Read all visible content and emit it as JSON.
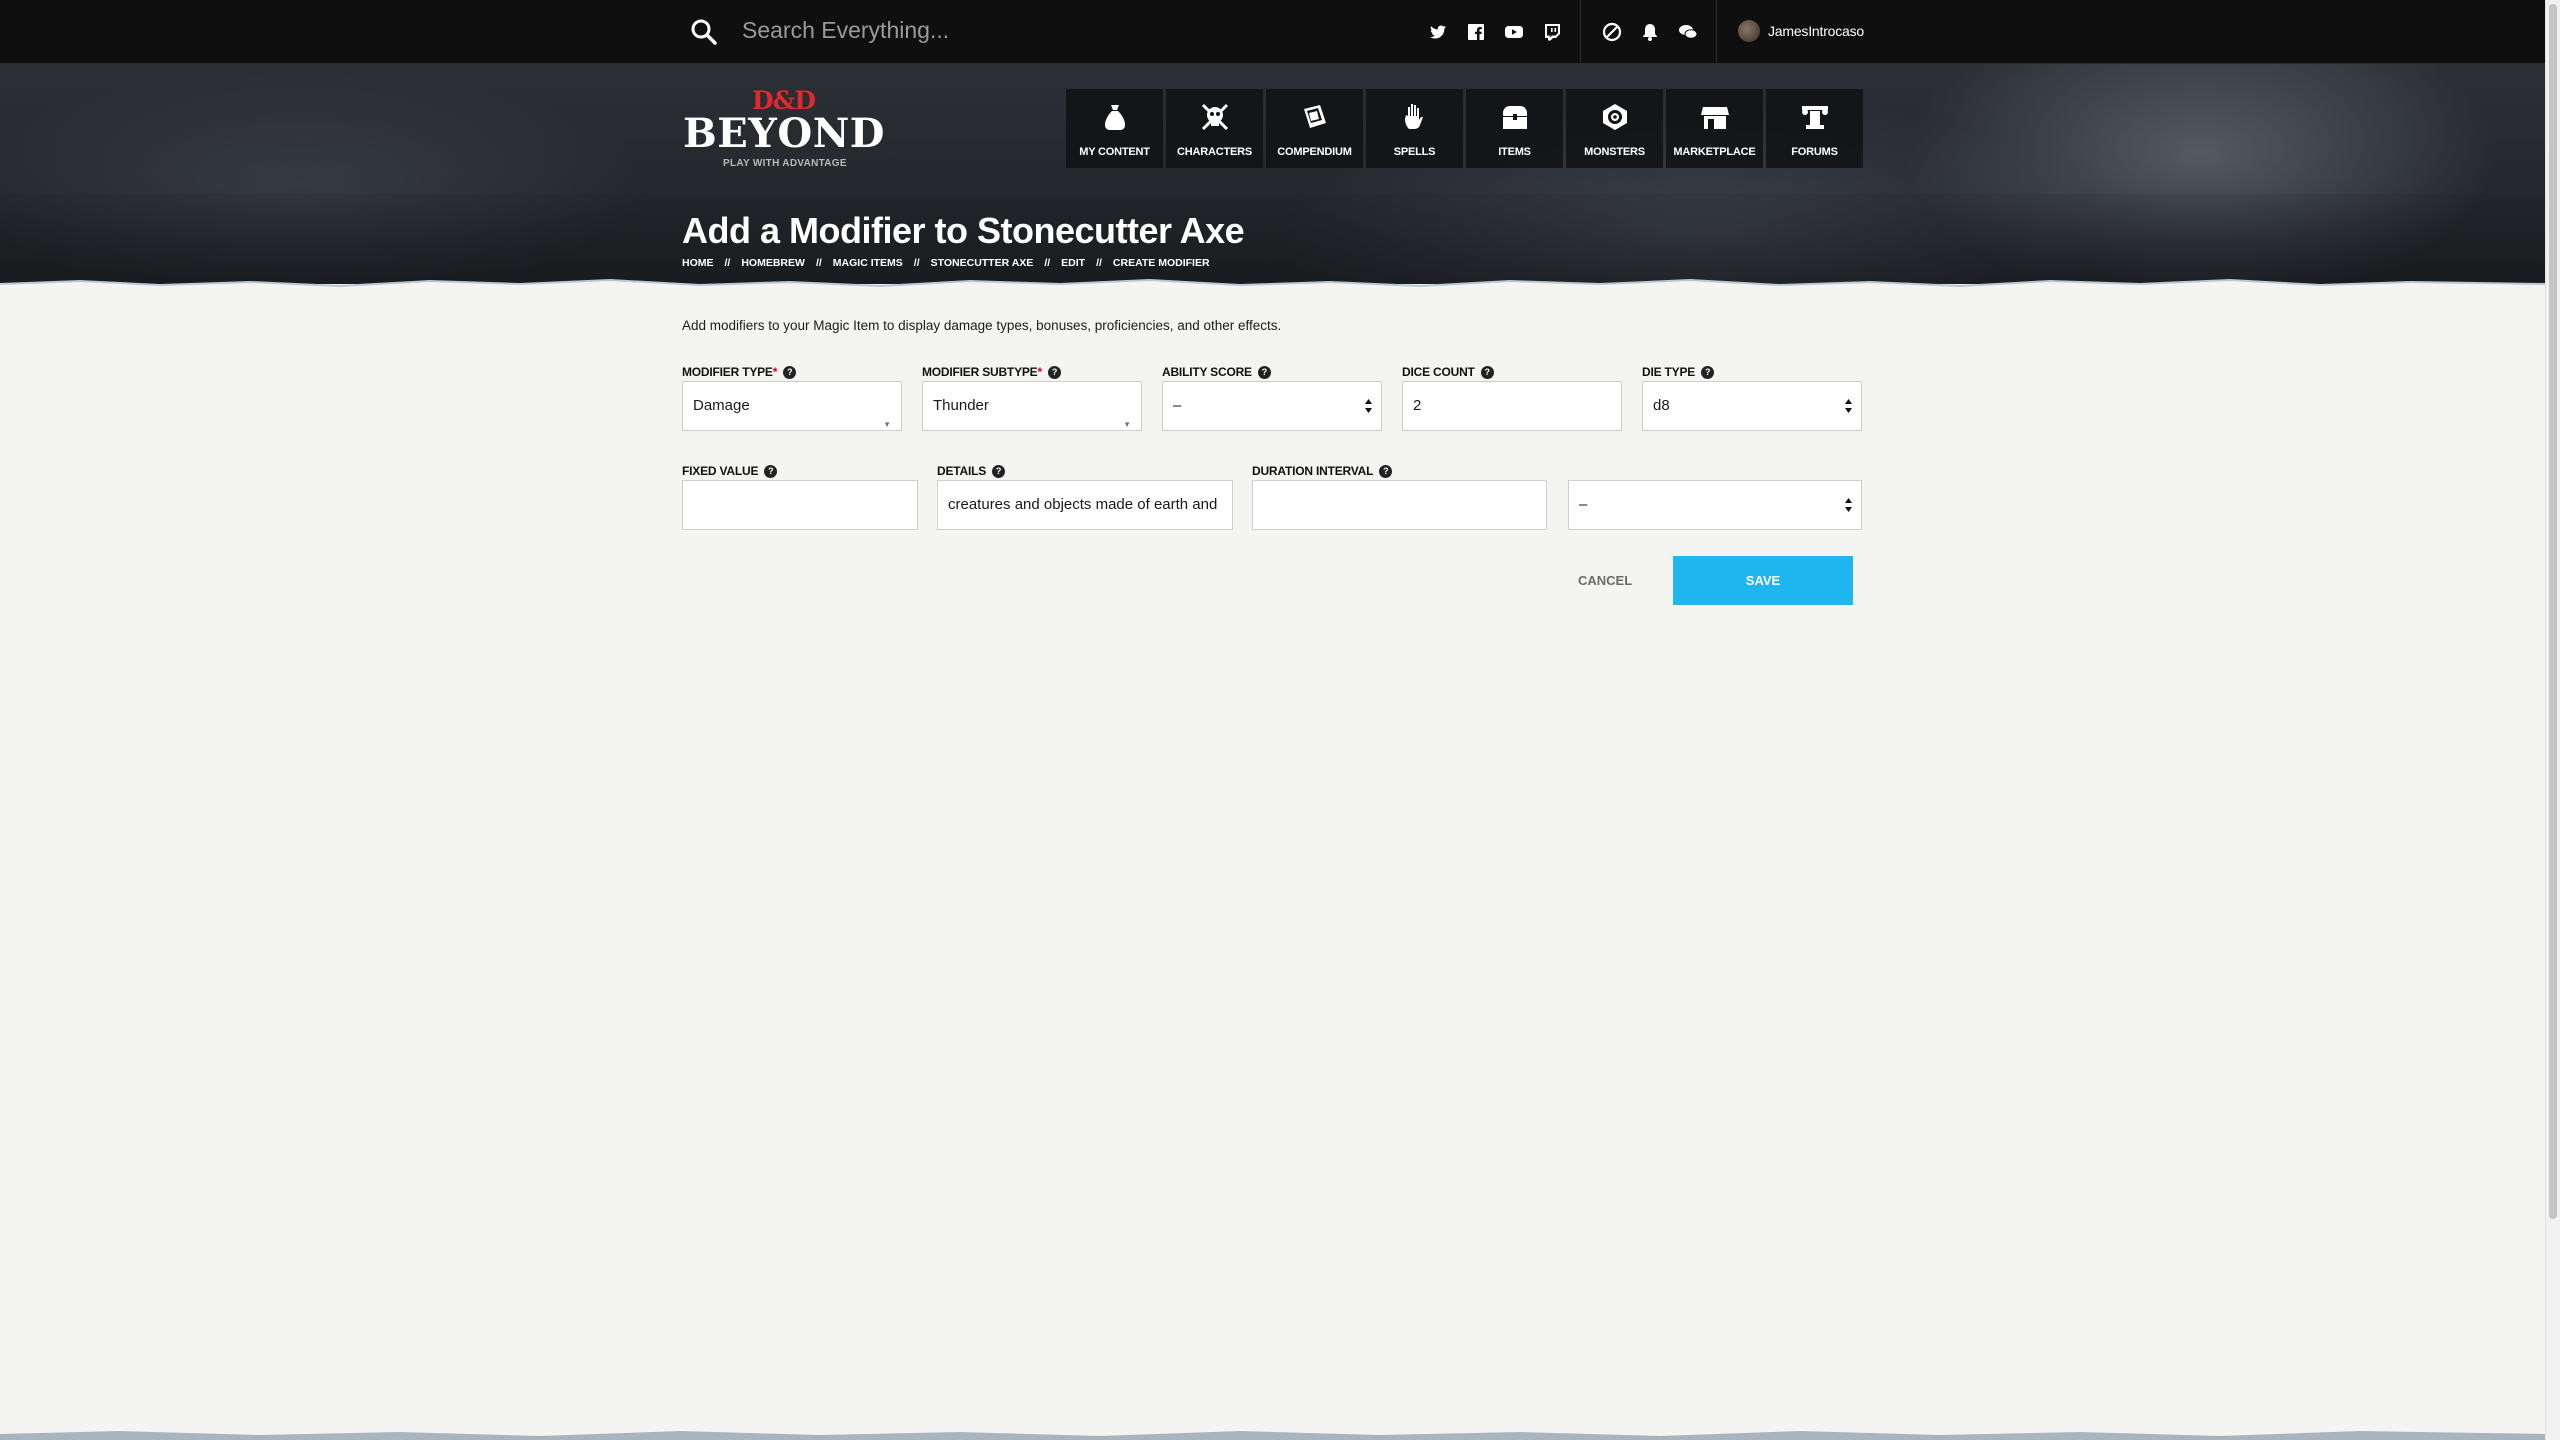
{
  "topbar": {
    "search_placeholder": "Search Everything...",
    "social": [
      "twitter-icon",
      "facebook-icon",
      "youtube-icon",
      "twitch-icon"
    ],
    "user_icons": [
      "dice-icon",
      "bell-icon",
      "chat-icon"
    ],
    "username": "JamesIntrocaso"
  },
  "logo": {
    "dd": "D&D",
    "beyond": "BEYOND",
    "tagline": "PLAY WITH ADVANTAGE"
  },
  "nav": [
    {
      "label": "MY CONTENT",
      "icon": "bag-icon"
    },
    {
      "label": "CHARACTERS",
      "icon": "skull-crossbones-icon"
    },
    {
      "label": "COMPENDIUM",
      "icon": "book-icon"
    },
    {
      "label": "SPELLS",
      "icon": "hand-icon"
    },
    {
      "label": "ITEMS",
      "icon": "chest-icon"
    },
    {
      "label": "MONSTERS",
      "icon": "beholder-icon"
    },
    {
      "label": "MARKETPLACE",
      "icon": "storefront-icon"
    },
    {
      "label": "FORUMS",
      "icon": "pillar-icon"
    }
  ],
  "page": {
    "title": "Add a Modifier to Stonecutter Axe",
    "breadcrumb": [
      "HOME",
      "HOMEBREW",
      "MAGIC ITEMS",
      "STONECUTTER AXE",
      "EDIT",
      "CREATE MODIFIER"
    ],
    "breadcrumb_sep": "//"
  },
  "form": {
    "intro": "Add modifiers to your Magic Item to display damage types, bonuses, proficiencies, and other effects.",
    "modifier_type": {
      "label": "MODIFIER TYPE",
      "required": "*",
      "value": "Damage"
    },
    "modifier_subtype": {
      "label": "MODIFIER SUBTYPE",
      "required": "*",
      "value": "Thunder"
    },
    "ability_score": {
      "label": "ABILITY SCORE",
      "value": "–"
    },
    "dice_count": {
      "label": "DICE COUNT",
      "value": "2"
    },
    "die_type": {
      "label": "DIE TYPE",
      "value": "d8"
    },
    "fixed_value": {
      "label": "FIXED VALUE",
      "value": ""
    },
    "details": {
      "label": "DETAILS",
      "value": "creatures and objects made of earth and"
    },
    "duration_interval": {
      "label": "DURATION INTERVAL",
      "value": ""
    },
    "duration_unit": {
      "value": "–"
    },
    "cancel_label": "CANCEL",
    "save_label": "SAVE"
  },
  "colors": {
    "accent": "#1fb6f0",
    "brand_red": "#e0292d",
    "required": "#d0021b"
  }
}
